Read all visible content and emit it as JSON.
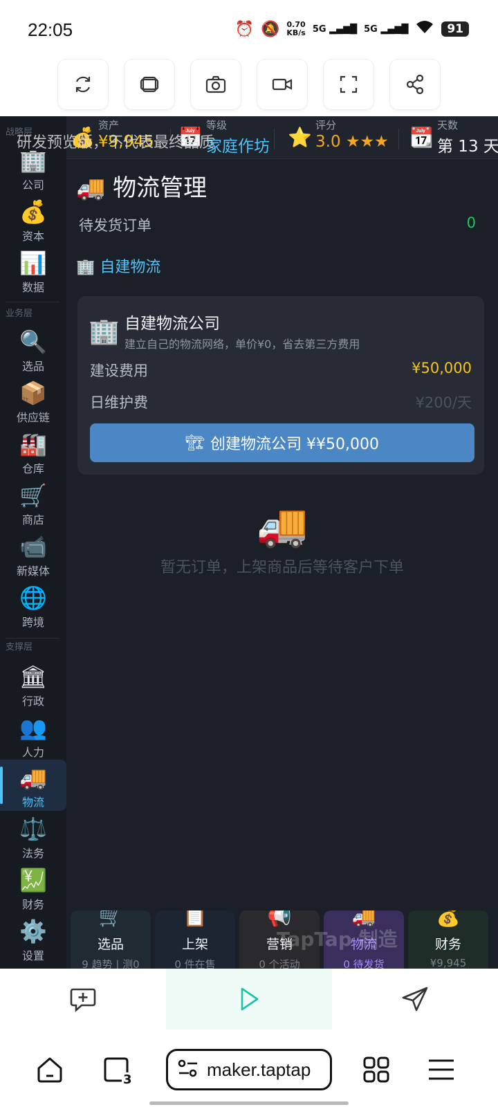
{
  "status": {
    "time": "22:05",
    "net_speed_value": "0.70",
    "net_speed_unit": "KB/s",
    "signal_1": "5G",
    "signal_2": "5G",
    "battery": "91"
  },
  "toolbar": {
    "buttons": [
      "refresh-icon",
      "layers-icon",
      "screenshot-icon",
      "record-video-icon",
      "fullscreen-icon",
      "share-icon"
    ]
  },
  "game": {
    "watermark": "研发预览版，不代表最终品质",
    "stats": [
      {
        "icon": "💰",
        "title": "资产",
        "value": "¥9,945",
        "color": "#f5c518"
      },
      {
        "icon": "📅",
        "title": "等级",
        "value": "家庭作坊",
        "color": "#4fc3f7"
      },
      {
        "icon": "⭐",
        "title": "评分",
        "value": "3.0 ★★★",
        "color": "#f5a623"
      },
      {
        "icon": "📆",
        "title": "天数",
        "value": "第 13 天",
        "color": "#f1f3f7"
      }
    ],
    "sidebar": {
      "layers": [
        "战略层",
        "业务层",
        "支撑层"
      ],
      "items": [
        {
          "icon": "🏢",
          "label": "公司"
        },
        {
          "icon": "💰",
          "label": "资本"
        },
        {
          "icon": "📊",
          "label": "数据"
        },
        {
          "icon": "🔍",
          "label": "选品"
        },
        {
          "icon": "📦",
          "label": "供应链"
        },
        {
          "icon": "🏭",
          "label": "仓库"
        },
        {
          "icon": "🛒",
          "label": "商店"
        },
        {
          "icon": "📹",
          "label": "新媒体"
        },
        {
          "icon": "🌐",
          "label": "跨境"
        },
        {
          "icon": "🏛",
          "label": "行政"
        },
        {
          "icon": "👥",
          "label": "人力"
        },
        {
          "icon": "🚚",
          "label": "物流"
        },
        {
          "icon": "⚖️",
          "label": "法务"
        },
        {
          "icon": "💹",
          "label": "财务"
        },
        {
          "icon": "⚙️",
          "label": "设置"
        }
      ],
      "active": "物流"
    },
    "main": {
      "title_icon": "🚚",
      "title": "物流管理",
      "pending_label": "待发货订单",
      "pending_value": "0",
      "section_icon": "🏢",
      "section_title": "自建物流",
      "card": {
        "icon": "🏢",
        "title": "自建物流公司",
        "desc": "建立自己的物流网络，单价¥0，省去第三方费用",
        "build_cost_label": "建设费用",
        "build_cost_value": "¥50,000",
        "daily_fee_label": "日维护费",
        "daily_fee_value": "¥200/天",
        "button_icon": "🏗",
        "button_label": "创建物流公司  ¥¥50,000"
      },
      "empty_icon": "🚚",
      "empty_text": "暂无订单，上架商品后等待客户下单"
    },
    "bottom_tabs": [
      {
        "icon": "🛒",
        "label": "选品",
        "sub": "9 趋势 | 测0",
        "bg": "#1f2a33"
      },
      {
        "icon": "📋",
        "label": "上架",
        "sub": "0 件在售",
        "bg": "#1d2533"
      },
      {
        "icon": "📢",
        "label": "营销",
        "sub": "0 个活动",
        "bg": "#2a2a2e"
      },
      {
        "icon": "🚚",
        "label": "物流",
        "sub": "0 待发货",
        "bg": "#3a2f5c"
      },
      {
        "icon": "💰",
        "label": "财务",
        "sub": "¥9,945",
        "bg": "#1f2d28"
      }
    ],
    "taptap_watermark": "TapTap 制造"
  },
  "browser": {
    "url": "maker.taptap",
    "tab_count": "3"
  }
}
